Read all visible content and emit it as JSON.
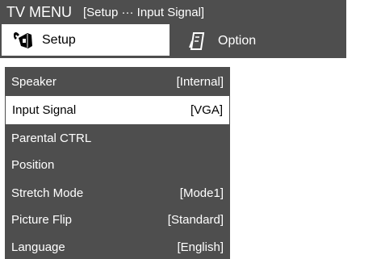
{
  "title": {
    "main": "TV MENU",
    "breadcrumb": "[Setup ··· Input Signal]"
  },
  "tabs": [
    {
      "label": "Setup",
      "icon": "setup-icon",
      "active": true
    },
    {
      "label": "Option",
      "icon": "option-icon",
      "active": false
    }
  ],
  "menu": {
    "items": [
      {
        "label": "Speaker",
        "value": "[Internal]"
      },
      {
        "label": "Input Signal",
        "value": "[VGA]",
        "selected": true
      },
      {
        "label": "Parental CTRL",
        "value": ""
      },
      {
        "label": "Position",
        "value": ""
      },
      {
        "label": "Stretch Mode",
        "value": "[Mode1]"
      },
      {
        "label": "Picture Flip",
        "value": "[Standard]"
      },
      {
        "label": "Language",
        "value": "[English]"
      }
    ]
  },
  "colors": {
    "panel": "#4e4e4e",
    "text_on_dark": "#ffffff",
    "highlight": "#ffffff"
  }
}
